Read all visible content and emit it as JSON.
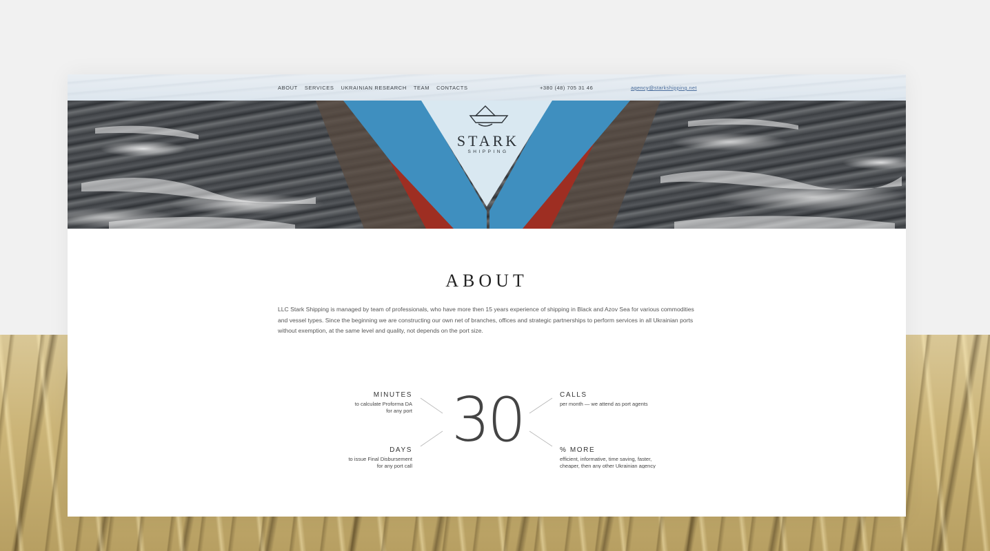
{
  "nav": {
    "items": [
      "ABOUT",
      "SERVICES",
      "UKRAINIAN RESEARCH",
      "TEAM",
      "CONTACTS"
    ],
    "phone": "+380 (48) 705 31 46",
    "email": "agency@starkshipping.net"
  },
  "logo": {
    "name": "STARK",
    "tagline": "SHIPPING"
  },
  "about": {
    "title": "ABOUT",
    "text": "LLC Stark Shipping is managed by team of professionals, who have more then 15 years experience of shipping in Black and Azov Sea for various commodities and vessel types. Since the beginning we are constructing our own net of branches, offices and strategic partnerships to perform services in all Ukrainian ports without exemption, at the same level and quality, not depends on the port size."
  },
  "stats": {
    "number": "30",
    "minutes": {
      "title": "MINUTES",
      "line1": "to calculate Proforma DA",
      "line2": "for any port"
    },
    "days": {
      "title": "DAYS",
      "line1": "to issue Final Disbursement",
      "line2": "for any port call"
    },
    "calls": {
      "title": "CALLS",
      "line1": "per month — we attend as port agents"
    },
    "more": {
      "title": "% MORE",
      "line1": "efficient, informative, time saving, faster,",
      "line2": "cheaper, then any other Ukrainian agency"
    }
  },
  "colors": {
    "hull_blue": "#3f8fbf",
    "hull_red": "#9e2e22",
    "link": "#4a6d9c",
    "wheat": "#cbb477"
  }
}
